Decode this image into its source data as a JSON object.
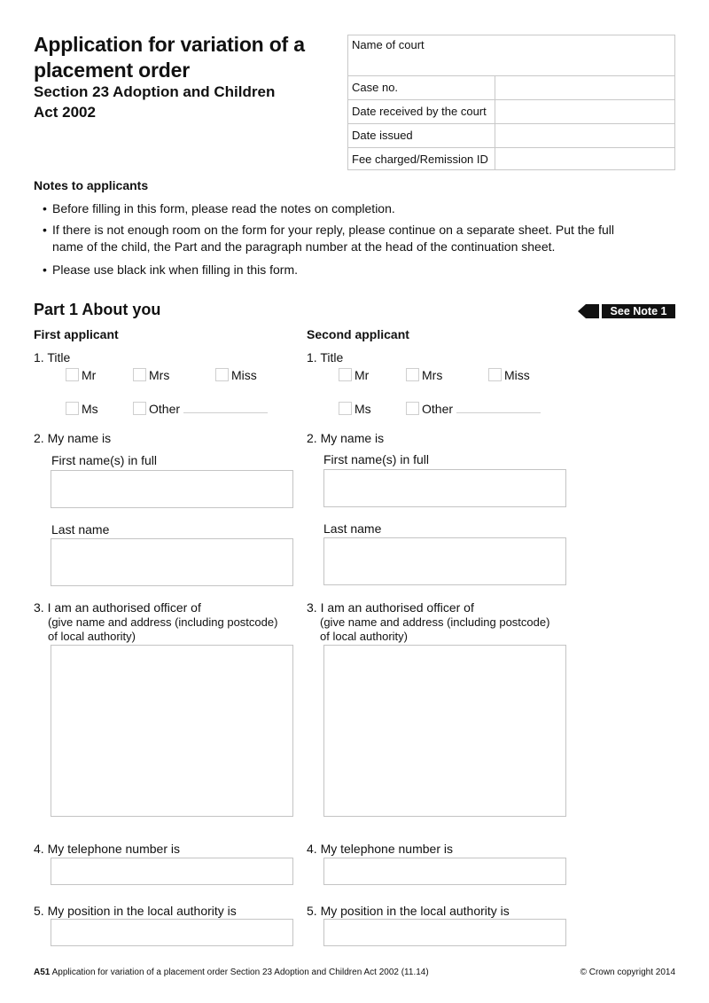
{
  "header": {
    "title": "Application for variation of a placement order",
    "subtitle": "Section 23 Adoption and Children Act 2002"
  },
  "court_box": {
    "name_of_court_label": "Name of court",
    "rows": [
      {
        "label": "Case no.",
        "value": ""
      },
      {
        "label": "Date received by the court",
        "value": ""
      },
      {
        "label": "Date issued",
        "value": ""
      },
      {
        "label": "Fee charged/Remission ID",
        "value": ""
      }
    ]
  },
  "notes": {
    "heading": "Notes to applicants",
    "bullet": "•",
    "items": [
      "Before filling in this form, please read the notes on completion.",
      "If there is not enough room on the form for your reply, please continue on a separate sheet. Put the full",
      "name of the child, the Part and the paragraph number at the head of the continuation sheet.",
      "Please use black ink when filling in this form."
    ]
  },
  "part1": {
    "heading": "Part 1 About you",
    "see_note": "See Note 1",
    "applicants": [
      {
        "heading": "First applicant",
        "q1": "1. Title",
        "titles": [
          "Mr",
          "Mrs",
          "Miss",
          "Ms",
          "Other"
        ],
        "q2": "2. My name is",
        "first_name_label": "First name(s) in full",
        "first_name_value": "",
        "last_name_label": "Last name",
        "last_name_value": "",
        "q3": "3. I am an authorised officer of",
        "q3_sub1": "(give name and address (including postcode)",
        "q3_sub2": "of local authority)",
        "authority_value": "",
        "q4": "4. My telephone number is",
        "telephone_value": "",
        "q5": "5. My position in the local authority is",
        "position_value": ""
      },
      {
        "heading": "Second applicant",
        "q1": "1. Title",
        "titles": [
          "Mr",
          "Mrs",
          "Miss",
          "Ms",
          "Other"
        ],
        "q2": "2. My name is",
        "first_name_label": "First name(s) in full",
        "first_name_value": "",
        "last_name_label": "Last name",
        "last_name_value": "",
        "q3": "3. I am an authorised officer of",
        "q3_sub1": "(give name and address (including postcode)",
        "q3_sub2": "of local authority)",
        "authority_value": "",
        "q4": "4. My telephone number is",
        "telephone_value": "",
        "q5": "5. My position in the local authority is",
        "position_value": ""
      }
    ]
  },
  "footer": {
    "form_code": "A51",
    "form_description": " Application for variation of a placement order Section 23 Adoption and Children Act 2002 (11.14)",
    "copyright": "© Crown copyright 2014"
  }
}
